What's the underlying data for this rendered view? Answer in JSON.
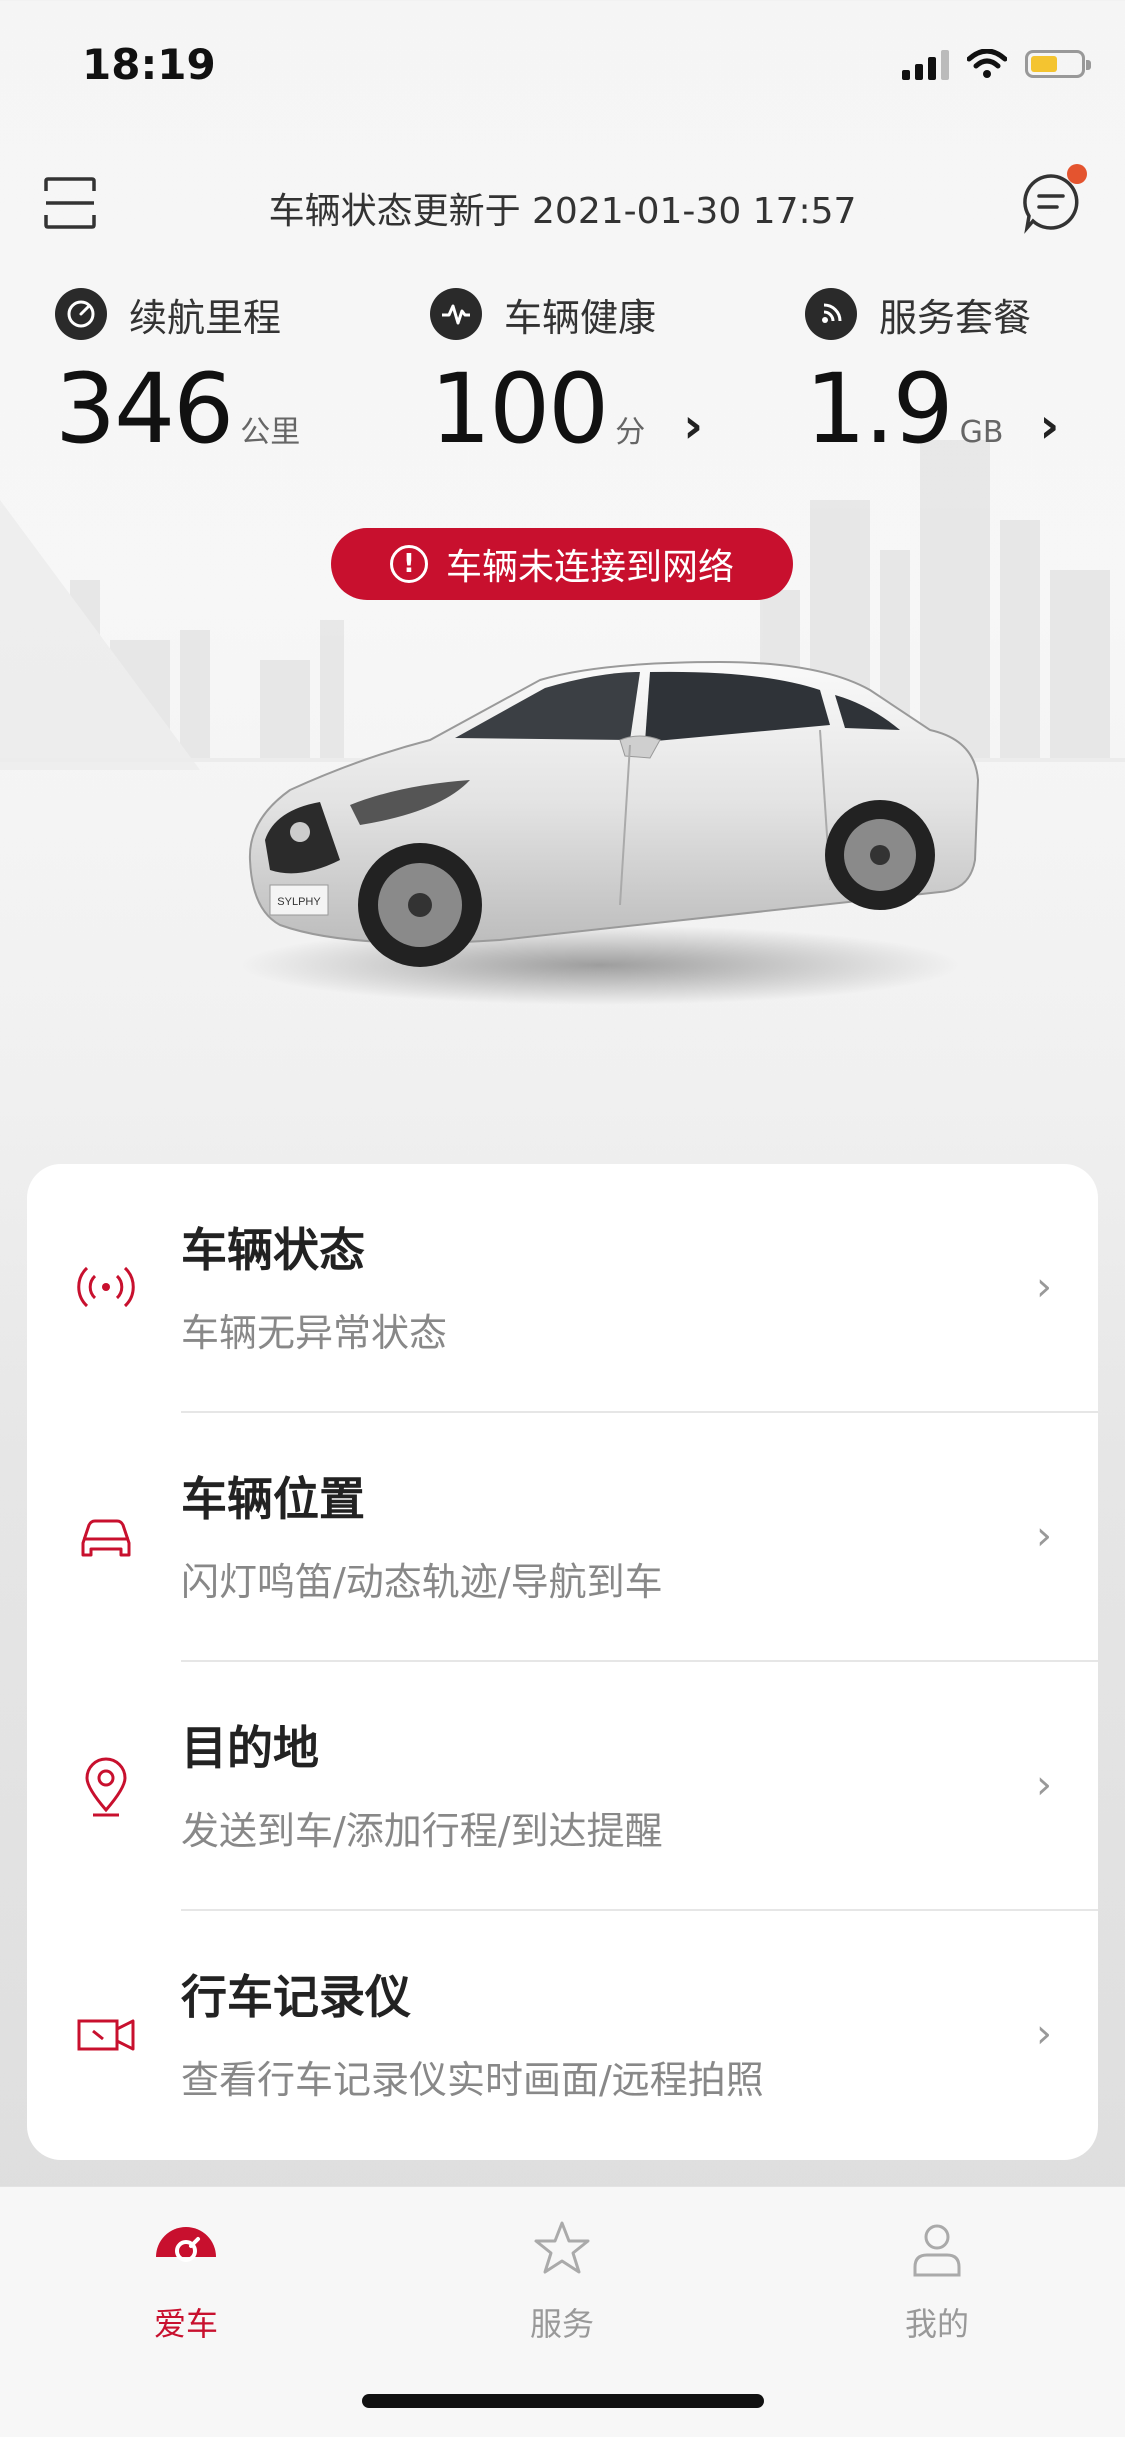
{
  "status_bar": {
    "time": "18:19"
  },
  "header": {
    "title": "车辆状态更新于 2021-01-30 17:57"
  },
  "stats": [
    {
      "label": "续航里程",
      "value": "346",
      "unit": "公里",
      "icon": "gauge-icon"
    },
    {
      "label": "车辆健康",
      "value": "100",
      "unit": "分",
      "icon": "heartbeat-icon"
    },
    {
      "label": "服务套餐",
      "value": "1.9",
      "unit": "GB",
      "icon": "signal-icon"
    }
  ],
  "warning": {
    "text": "车辆未连接到网络",
    "icon": "!"
  },
  "car": {
    "plate_text": "SYLPHY"
  },
  "menu": [
    {
      "title": "车辆状态",
      "subtitle": "车辆无异常状态",
      "icon": "broadcast-icon"
    },
    {
      "title": "车辆位置",
      "subtitle": "闪灯鸣笛/动态轨迹/导航到车",
      "icon": "car-icon"
    },
    {
      "title": "目的地",
      "subtitle": "发送到车/添加行程/到达提醒",
      "icon": "location-pin-icon"
    },
    {
      "title": "行车记录仪",
      "subtitle": "查看行车记录仪实时画面/远程拍照",
      "icon": "camera-icon"
    }
  ],
  "tabs": [
    {
      "label": "爱车",
      "active": true,
      "icon": "car-tab-icon"
    },
    {
      "label": "服务",
      "active": false,
      "icon": "star-icon"
    },
    {
      "label": "我的",
      "active": false,
      "icon": "user-icon"
    }
  ],
  "colors": {
    "accent": "#c8102e",
    "badge": "#e4542f"
  }
}
